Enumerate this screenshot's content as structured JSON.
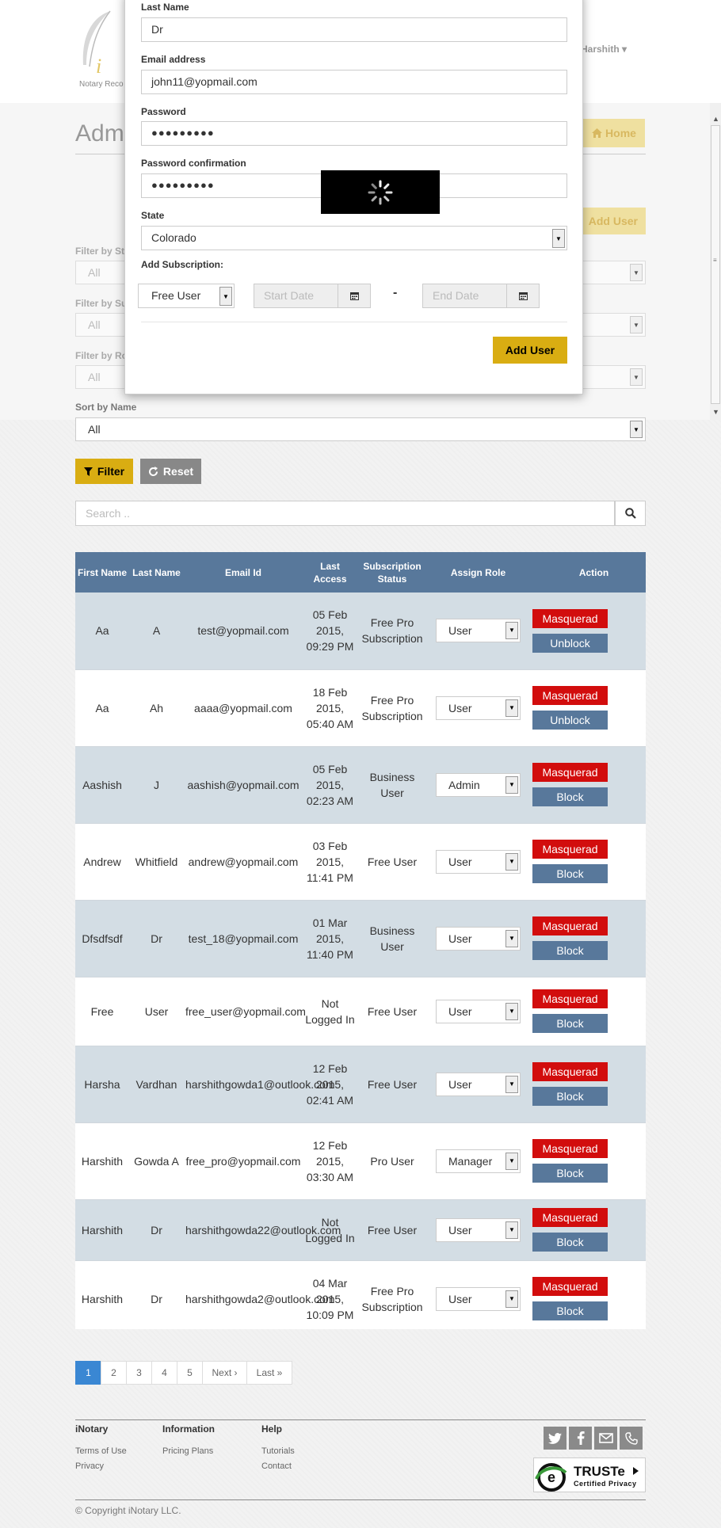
{
  "brand": {
    "logo_letter": "i",
    "tagline": "Notary Reco"
  },
  "header": {
    "user_name": "Harshith",
    "user_caret": "▾"
  },
  "page": {
    "title": "Adm",
    "home_label": "Home",
    "add_user_label": "Add User"
  },
  "filters": {
    "status_label": "Filter by Sta",
    "status_value": "All",
    "subscription_label": "Filter by Su",
    "subscription_value": "All",
    "role_label": "Filter by Ro",
    "role_value": "All",
    "sort_label": "Sort by Name",
    "sort_value": "All",
    "filter_button": "Filter",
    "reset_button": "Reset",
    "search_placeholder": "Search .."
  },
  "table": {
    "headers": {
      "first_name": "First Name",
      "last_name": "Last Name",
      "email": "Email Id",
      "last_access": "Last Access",
      "subscription": "Subscription Status",
      "role": "Assign Role",
      "action": "Action"
    },
    "masquerade_label": "Masquerad",
    "rows": [
      {
        "first": "Aa",
        "last": "A",
        "email": "test@yopmail.com",
        "access": "05 Feb 2015, 09:29 PM",
        "subscription": "Free Pro Subscription",
        "role": "User",
        "block": "Unblock"
      },
      {
        "first": "Aa",
        "last": "Ah",
        "email": "aaaa@yopmail.com",
        "access": "18 Feb 2015, 05:40 AM",
        "subscription": "Free Pro Subscription",
        "role": "User",
        "block": "Unblock"
      },
      {
        "first": "Aashish",
        "last": "J",
        "email": "aashish@yopmail.com",
        "access": "05 Feb 2015, 02:23 AM",
        "subscription": "Business User",
        "role": "Admin",
        "block": "Block"
      },
      {
        "first": "Andrew",
        "last": "Whitfield",
        "email": "andrew@yopmail.com",
        "access": "03 Feb 2015, 11:41 PM",
        "subscription": "Free User",
        "role": "User",
        "block": "Block"
      },
      {
        "first": "Dfsdfsdf",
        "last": "Dr",
        "email": "test_18@yopmail.com",
        "access": "01 Mar 2015, 11:40 PM",
        "subscription": "Business User",
        "role": "User",
        "block": "Block"
      },
      {
        "first": "Free",
        "last": "User",
        "email": "free_user@yopmail.com",
        "access": "Not Logged In",
        "subscription": "Free User",
        "role": "User",
        "block": "Block"
      },
      {
        "first": "Harsha",
        "last": "Vardhan",
        "email": "harshithgowda1@outlook.com",
        "access": "12 Feb 2015, 02:41 AM",
        "subscription": "Free User",
        "role": "User",
        "block": "Block"
      },
      {
        "first": "Harshith",
        "last": "Gowda A",
        "email": "free_pro@yopmail.com",
        "access": "12 Feb 2015, 03:30 AM",
        "subscription": "Pro User",
        "role": "Manager",
        "block": "Block"
      },
      {
        "first": "Harshith",
        "last": "Dr",
        "email": "harshithgowda22@outlook.com",
        "access": "Not Logged In",
        "subscription": "Free User",
        "role": "User",
        "block": "Block"
      },
      {
        "first": "Harshith",
        "last": "Dr",
        "email": "harshithgowda2@outlook.com",
        "access": "04 Mar 2015, 10:09 PM",
        "subscription": "Free Pro Subscription",
        "role": "User",
        "block": "Block"
      }
    ]
  },
  "pagination": {
    "pages": [
      "1",
      "2",
      "3",
      "4",
      "5"
    ],
    "next": "Next ›",
    "last": "Last »",
    "active": "1"
  },
  "footer": {
    "col1_title": "iNotary",
    "col1_links": [
      "Terms of Use",
      "Privacy"
    ],
    "col2_title": "Information",
    "col2_links": [
      "Pricing Plans"
    ],
    "col3_title": "Help",
    "col3_links": [
      "Tutorials",
      "Contact"
    ],
    "truste_name": "TRUSTe",
    "truste_sub": "Certified Privacy",
    "copyright": "© Copyright iNotary LLC."
  },
  "modal": {
    "last_name_label": "Last Name",
    "last_name_value": "Dr",
    "email_label": "Email address",
    "email_value": "john11@yopmail.com",
    "password_label": "Password",
    "password_value": "●●●●●●●●●",
    "password_confirm_label": "Password confirmation",
    "password_confirm_value": "●●●●●●●●●",
    "state_label": "State",
    "state_value": "Colorado",
    "subscription_label": "Add Subscription:",
    "subscription_value": "Free User",
    "start_placeholder": "Start Date",
    "end_placeholder": "End Date",
    "separator": "-",
    "add_button": "Add User"
  },
  "colors": {
    "accent": "#d9ad12",
    "table_header": "#58789b",
    "masquerade": "#d20d0d",
    "pager_active": "#3a87d3"
  }
}
